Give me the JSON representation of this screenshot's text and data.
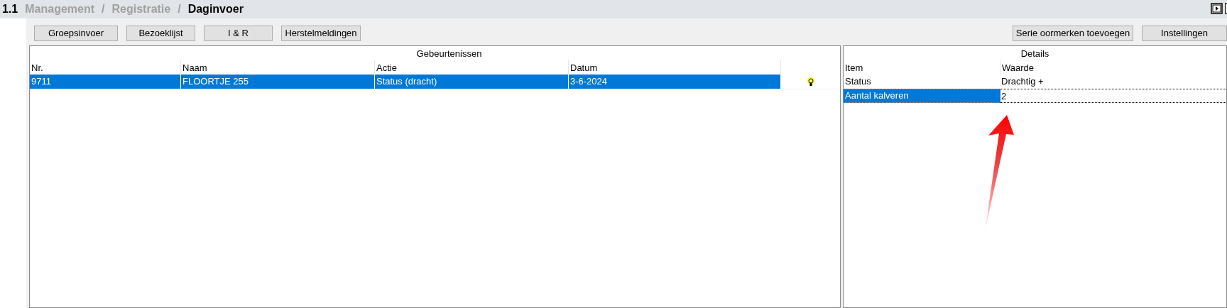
{
  "breadcrumb": {
    "number": "1.1",
    "parents": [
      "Management",
      "Registratie"
    ],
    "separator": "/",
    "current": "Daginvoer"
  },
  "toolbar": {
    "left_buttons": [
      {
        "label": "Groepsinvoer"
      },
      {
        "label": "Bezoeklijst"
      },
      {
        "label": "I & R"
      },
      {
        "label": "Herstelmeldingen"
      }
    ],
    "right_buttons": [
      {
        "label": "Serie oormerken toevoegen"
      },
      {
        "label": "Instellingen"
      }
    ]
  },
  "events": {
    "title": "Gebeurtenissen",
    "columns": [
      "Nr.",
      "Naam",
      "Actie",
      "Datum"
    ],
    "rows": [
      {
        "cells": [
          "9711",
          "FLOORTJE 255",
          "Status (dracht)",
          "3-6-2024"
        ],
        "selected": true,
        "hint": true
      }
    ]
  },
  "details": {
    "title": "Details",
    "columns": [
      "Item",
      "Waarde"
    ],
    "rows": [
      {
        "item": "Status",
        "value": "Drachtig +",
        "selected": false,
        "kind": "text"
      },
      {
        "item": "Aantal kalveren",
        "value": "2",
        "selected": true,
        "kind": "input"
      }
    ]
  }
}
